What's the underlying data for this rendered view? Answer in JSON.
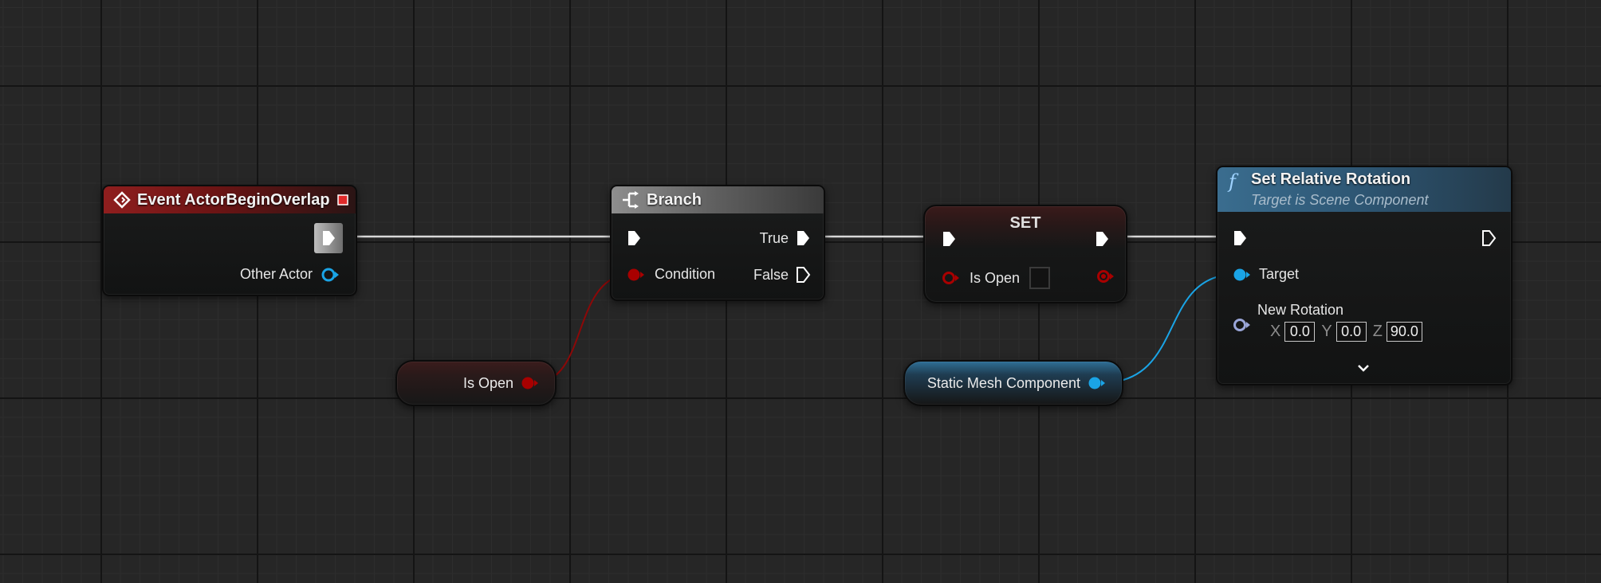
{
  "graph": {
    "event_node": {
      "title": "Event ActorBeginOverlap",
      "other_actor_label": "Other Actor"
    },
    "branch_node": {
      "title": "Branch",
      "condition_label": "Condition",
      "true_label": "True",
      "false_label": "False"
    },
    "set_node": {
      "title": "SET",
      "is_open_label": "Is Open"
    },
    "rotation_node": {
      "title": "Set Relative Rotation",
      "subtitle": "Target is Scene Component",
      "target_label": "Target",
      "new_rotation_label": "New Rotation",
      "x_label": "X",
      "x_value": "0.0",
      "y_label": "Y",
      "y_value": "0.0",
      "z_label": "Z",
      "z_value": "90.0"
    },
    "is_open_getter": {
      "label": "Is Open"
    },
    "static_mesh_getter": {
      "label": "Static Mesh Component"
    }
  },
  "colors": {
    "exec_wire": "#d8d8d8",
    "bool_pin": "#a80000",
    "object_pin": "#1aa4e6",
    "struct_pin": "#9aa6d8",
    "event_header": "#8f1e1e",
    "branch_header": "#8e8e8e",
    "function_header": "#3a6d8f"
  }
}
